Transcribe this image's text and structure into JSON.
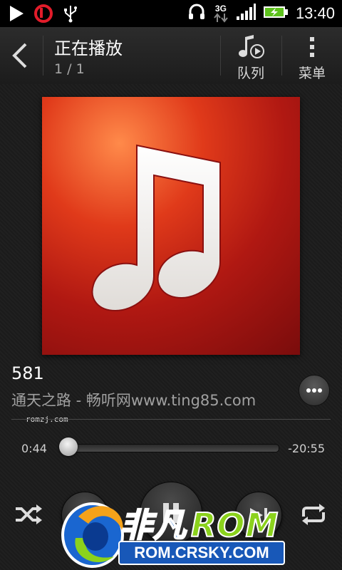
{
  "status_bar": {
    "time": "13:40",
    "network_label": "3G",
    "icons": [
      "play-icon",
      "beats-icon",
      "usb-icon",
      "headset-icon",
      "signal-icon",
      "battery-charging-icon"
    ]
  },
  "action_bar": {
    "title": "正在播放",
    "subtitle": "1 / 1",
    "queue_label": "队列",
    "menu_label": "菜单"
  },
  "track": {
    "title": "581",
    "artist_line": "通天之路 - 畅听网www.ting85.com",
    "watermark": "romzj.com"
  },
  "progress": {
    "elapsed": "0:44",
    "remaining": "-20:55",
    "fraction": 0.034
  },
  "controls": {
    "buttons": [
      "shuffle-icon",
      "previous-icon",
      "pause-icon",
      "next-icon",
      "repeat-icon"
    ]
  },
  "watermark_logo": {
    "name_cn": "非凡",
    "name_en": "ROM",
    "domain": "ROM.CRSKY.COM"
  },
  "colors": {
    "album_red": "#b01812",
    "logo_blue": "#1a6cd6",
    "logo_green": "#8bd21c"
  }
}
